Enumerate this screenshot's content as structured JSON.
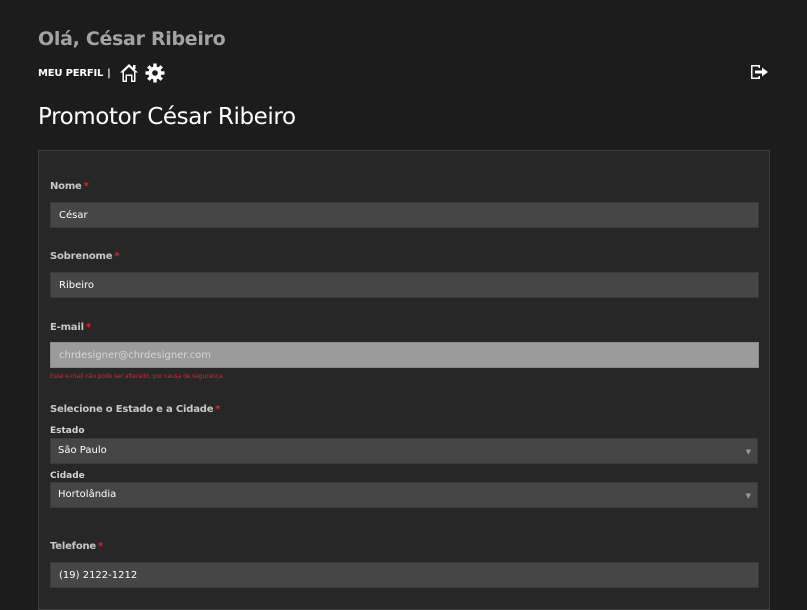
{
  "header": {
    "greeting": "Olá, César Ribeiro",
    "profile_link": "MEU PERFIL",
    "separator": "|",
    "icons": {
      "home": "home-icon",
      "settings": "gear-icon",
      "logout": "logout-icon"
    }
  },
  "page": {
    "title": "Promotor César Ribeiro"
  },
  "form": {
    "required_mark": "*",
    "first_name": {
      "label": "Nome",
      "value": "César"
    },
    "last_name": {
      "label": "Sobrenome",
      "value": "Ribeiro"
    },
    "email": {
      "label": "E-mail",
      "value": "chrdesigner@chrdesigner.com",
      "help": "Esse e-mail não pode ser alterado, por causa de segurança."
    },
    "location": {
      "label": "Selecione o Estado e a Cidade",
      "state_label": "Estado",
      "state_value": "São Paulo",
      "city_label": "Cidade",
      "city_value": "Hortolândia"
    },
    "phone": {
      "label": "Telefone",
      "value": "(19) 2122-1212"
    }
  },
  "colors": {
    "background": "#1c1c1c",
    "panel": "#272727",
    "field": "#464646",
    "required": "#d9262c"
  }
}
